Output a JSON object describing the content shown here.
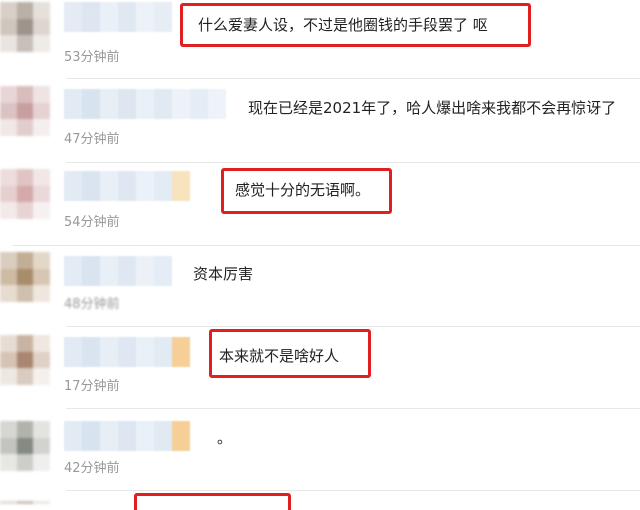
{
  "comments": [
    {
      "text": "什么爱妻人设，不过是他圈钱的手段罢了 呕",
      "time": "53分钟前",
      "highlighted": true
    },
    {
      "text": "现在已经是2021年了，哈人爆出啥来我都不会再惊讶了",
      "time": "47分钟前",
      "highlighted": false
    },
    {
      "text": "感觉十分的无语啊。",
      "time": "54分钟前",
      "highlighted": true
    },
    {
      "text": "资本厉害",
      "time": "48分钟前",
      "highlighted": false
    },
    {
      "text": "本来就不是啥好人",
      "time": "17分钟前",
      "highlighted": true
    },
    {
      "text": "。",
      "time": "42分钟前",
      "highlighted": false
    },
    {
      "text": "",
      "time": "",
      "highlighted": true
    }
  ],
  "colors": {
    "highlight": "#e02020",
    "time_text": "#999999",
    "comment_text": "#222222"
  }
}
